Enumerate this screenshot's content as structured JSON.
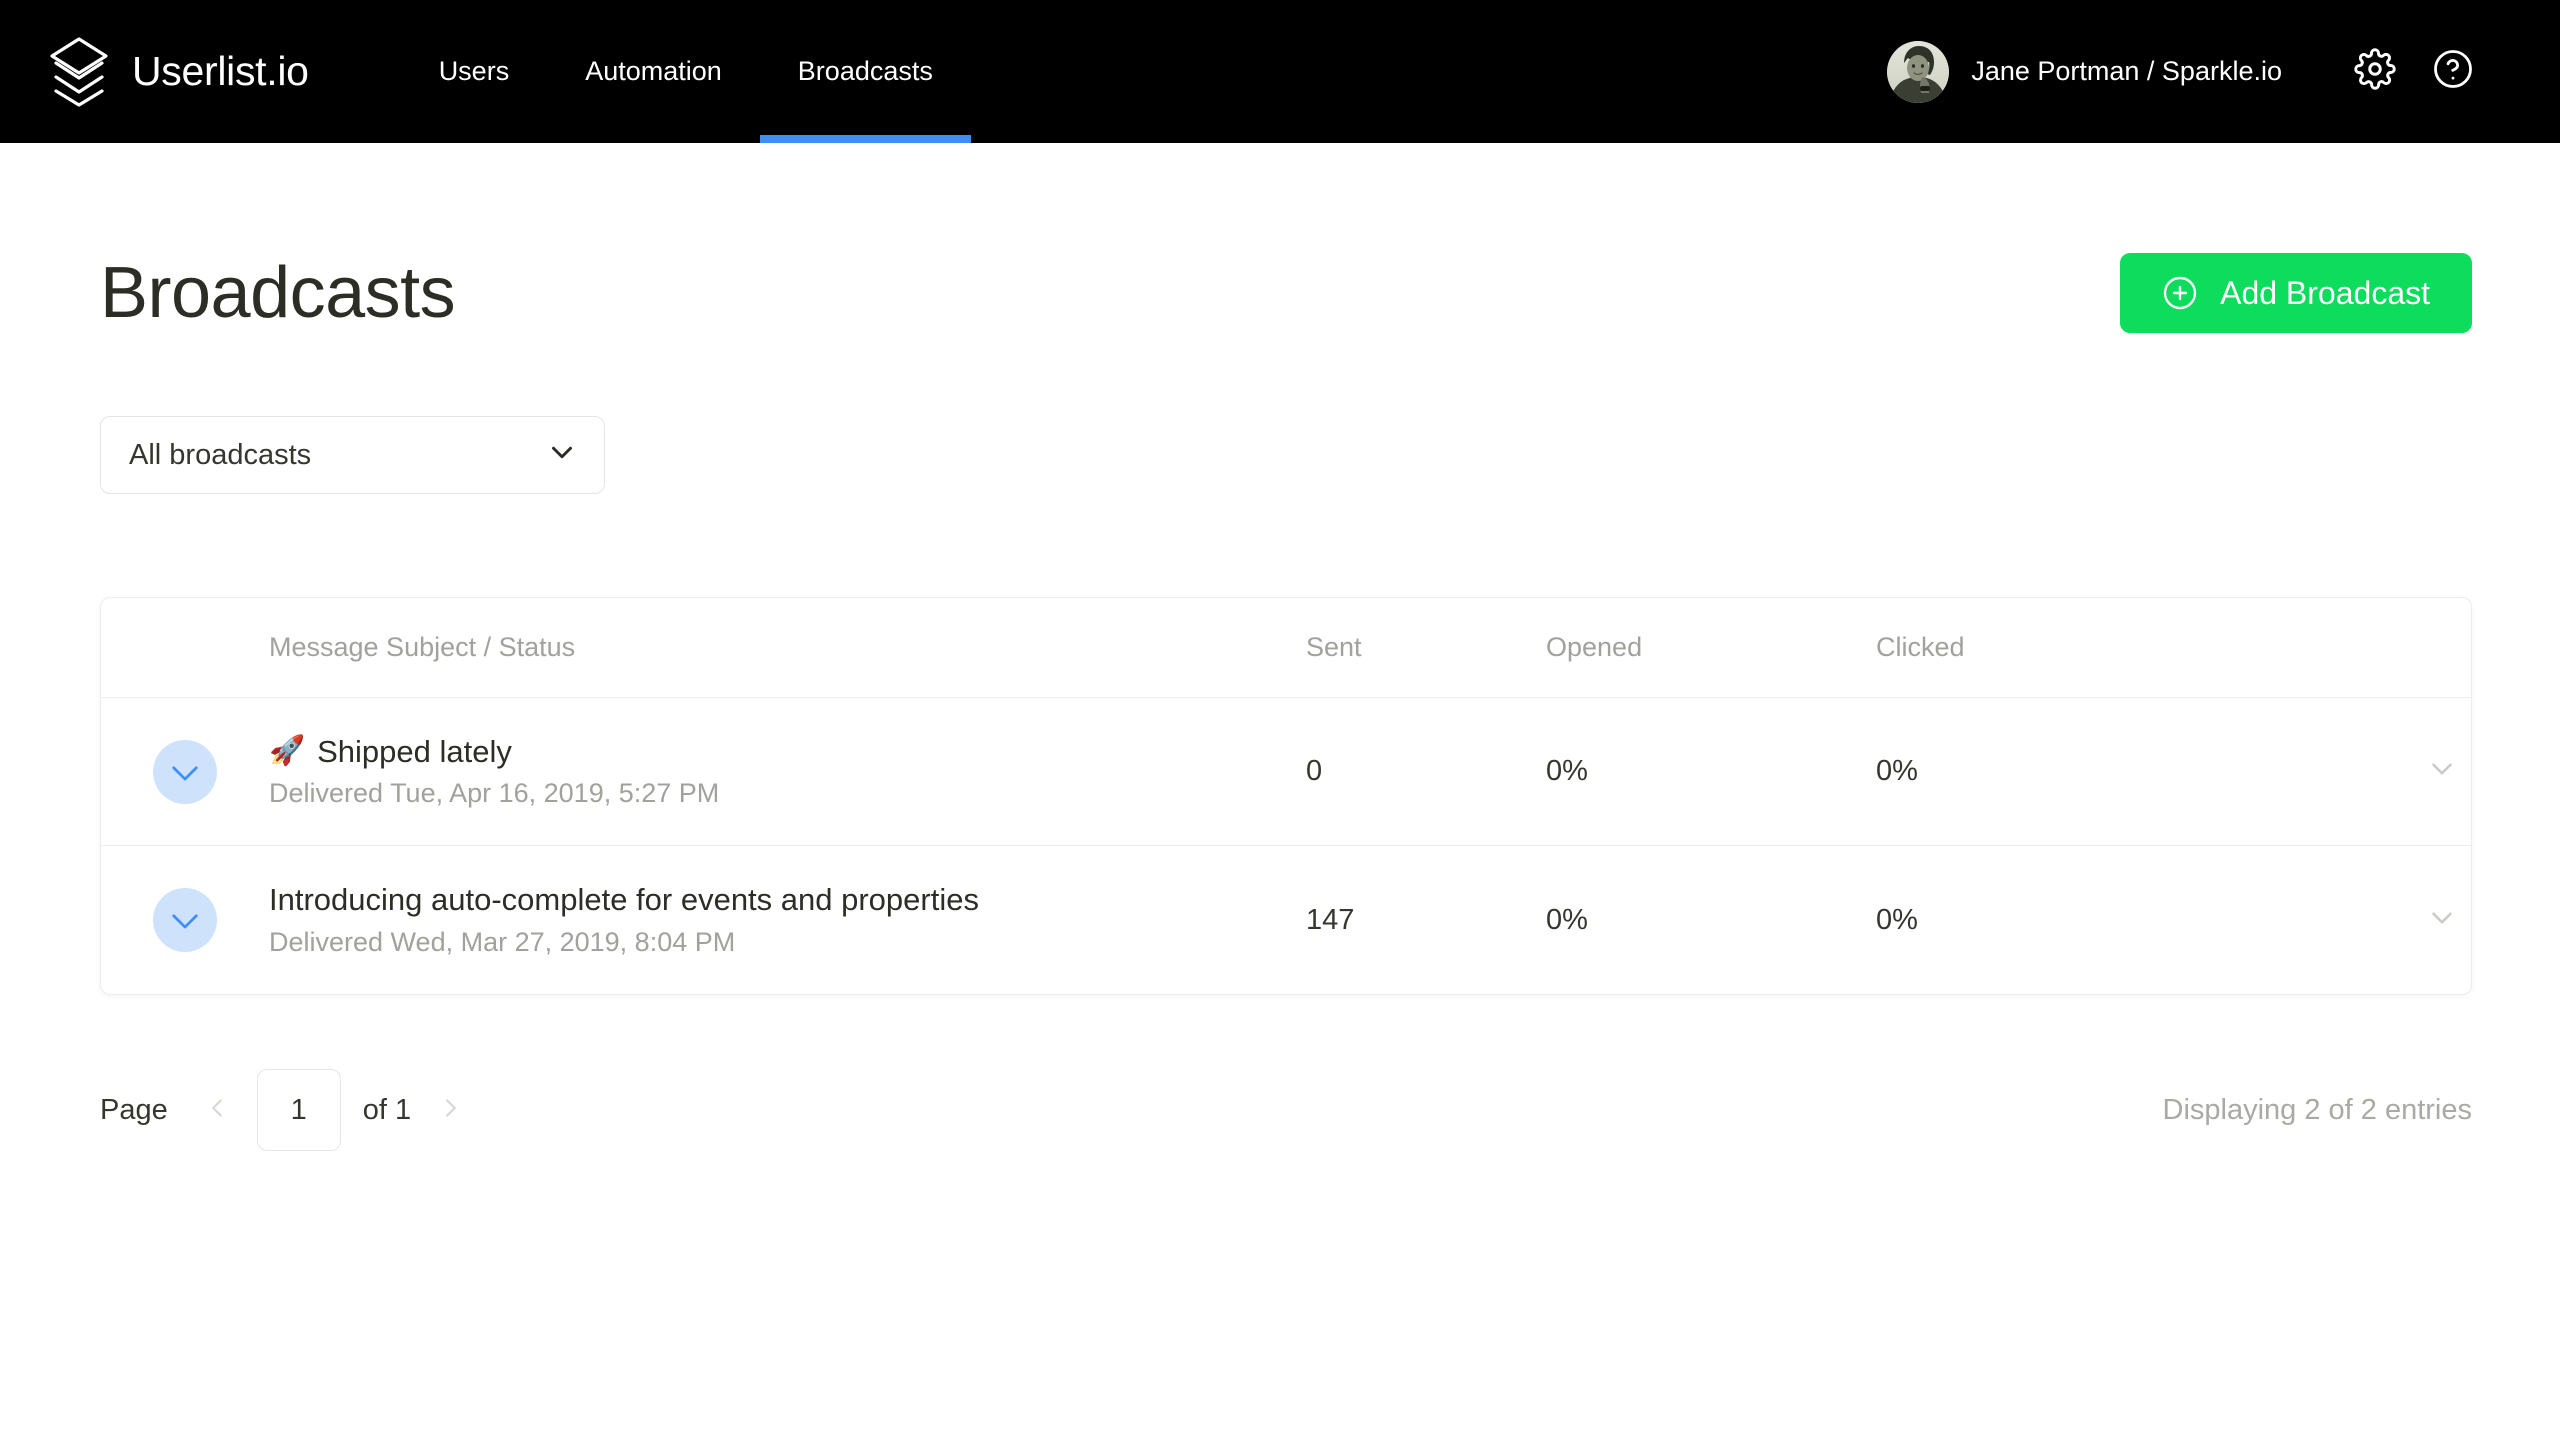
{
  "navbar": {
    "brand": {
      "name": "Userlist.io",
      "logo_icon": "stacked-layers-logo"
    },
    "links": [
      {
        "label": "Users",
        "active": false
      },
      {
        "label": "Automation",
        "active": false
      },
      {
        "label": "Broadcasts",
        "active": true
      }
    ],
    "account": {
      "name": "Jane Portman / Sparkle.io",
      "avatar_icon": "user-avatar-photo"
    },
    "settings_icon": "gear-icon",
    "help_icon": "question-mark-circle-icon",
    "active_tab_color": "#3d8ef8"
  },
  "page": {
    "title": "Broadcasts",
    "add_button": {
      "label": "Add Broadcast",
      "icon": "plus-circle-icon",
      "color": "#0ddc5c"
    }
  },
  "filter": {
    "selected": "All broadcasts",
    "chevron_icon": "chevron-down-icon"
  },
  "table": {
    "columns": [
      "",
      "Message Subject / Status",
      "Sent",
      "Opened",
      "Clicked",
      ""
    ],
    "headers": {
      "subject": "Message Subject / Status",
      "sent": "Sent",
      "opened": "Opened",
      "clicked": "Clicked"
    },
    "rows": [
      {
        "status_icon": "check-circle-icon",
        "emoji": "🚀",
        "subject": "Shipped lately",
        "status": "Delivered Tue, Apr 16, 2019, 5:27 PM",
        "sent": "0",
        "opened": "0%",
        "clicked": "0%",
        "expand_icon": "chevron-down-icon"
      },
      {
        "status_icon": "check-circle-icon",
        "emoji": "",
        "subject": "Introducing auto-complete for events and properties",
        "status": "Delivered Wed, Mar 27, 2019, 8:04 PM",
        "sent": "147",
        "opened": "0%",
        "clicked": "0%",
        "expand_icon": "chevron-down-icon"
      }
    ]
  },
  "pagination": {
    "page_label": "Page",
    "prev_icon": "chevron-left-icon",
    "next_icon": "chevron-right-icon",
    "current_page": "1",
    "of_label": "of 1",
    "entries": "Displaying 2 of 2 entries"
  }
}
